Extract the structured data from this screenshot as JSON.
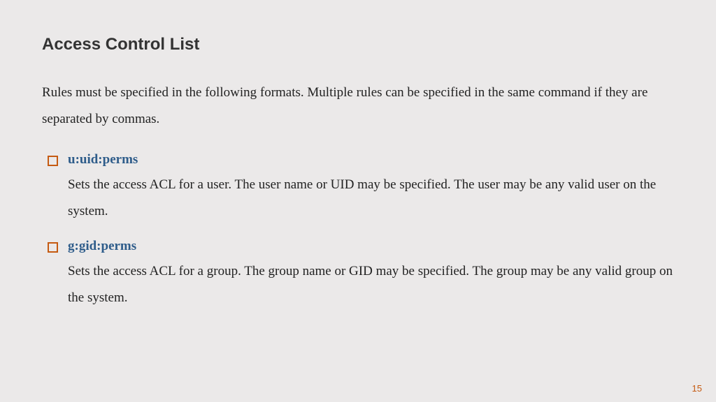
{
  "slide": {
    "title": "Access Control List",
    "intro": "Rules must be specified in the following formats. Multiple rules can be specified in the same command if they are separated by commas.",
    "rules": [
      {
        "label": "u:uid:perms",
        "desc": "Sets the access ACL for a user. The user name or UID may be specified. The user may be any valid user on the system."
      },
      {
        "label": "g:gid:perms",
        "desc": "Sets the access ACL for a group. The group name or GID may be specified. The group may be any valid group on the system."
      }
    ],
    "page_number": "15"
  }
}
